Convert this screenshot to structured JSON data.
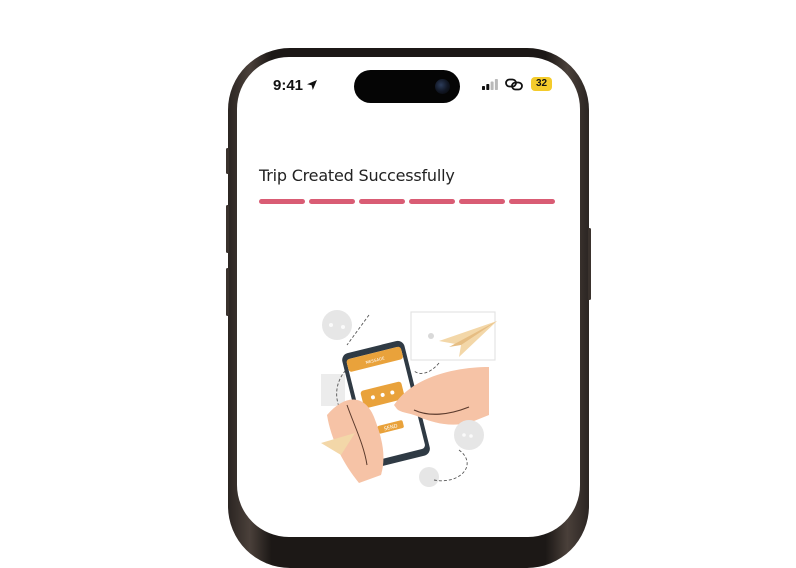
{
  "status_bar": {
    "time": "9:41",
    "battery_level": "32",
    "icons": [
      "location-arrow-icon",
      "cellular-signal-icon",
      "link-icon",
      "battery-icon"
    ]
  },
  "page": {
    "title": "Trip Created Successfully"
  },
  "progress": {
    "total_steps": 6,
    "completed_steps": 6,
    "color": "#d95c74"
  },
  "illustration": {
    "icon": "send-message-illustration-icon",
    "phone_header": "MESSAGE",
    "send_label": "SEND",
    "accent_color": "#e9a23b",
    "skin_color": "#f6c3a6"
  },
  "colors": {
    "frame": "#1c1816",
    "screen": "#ffffff",
    "battery": "#f4cb2b"
  }
}
